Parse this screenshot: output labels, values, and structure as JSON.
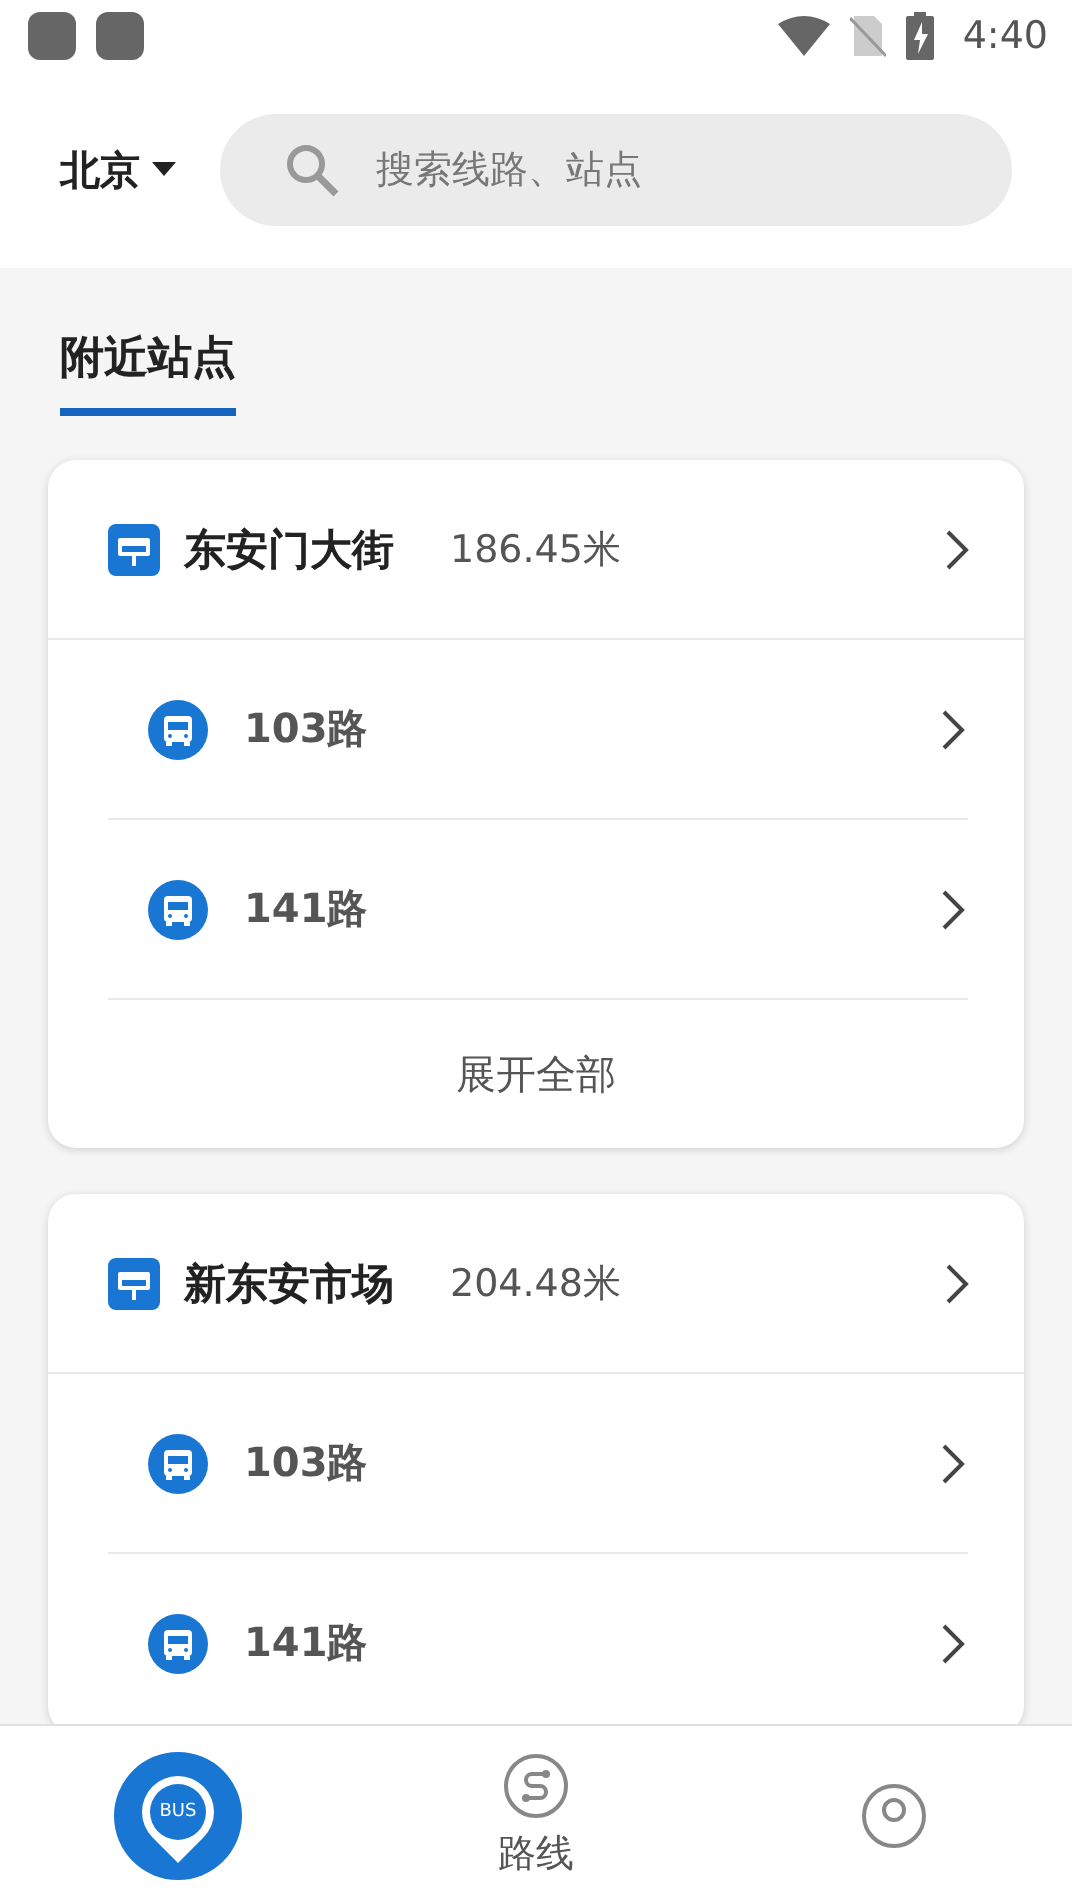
{
  "status_bar": {
    "time": "4:40"
  },
  "header": {
    "city": "北京",
    "search": {
      "placeholder": "搜索线路、站点"
    }
  },
  "section_tabs": [
    {
      "label": "附近站点",
      "selected": true
    }
  ],
  "stations": [
    {
      "name": "东安门大街",
      "distance": "186.45米",
      "routes": [
        {
          "name": "103路"
        },
        {
          "name": "141路"
        }
      ],
      "expand_label": "展开全部"
    },
    {
      "name": "新东安市场",
      "distance": "204.48米",
      "routes": [
        {
          "name": "103路"
        },
        {
          "name": "141路"
        }
      ]
    }
  ],
  "bottom_nav": [
    {
      "kind": "bus",
      "label": "BUS",
      "selected": true
    },
    {
      "kind": "route",
      "label": "路线",
      "selected": false
    },
    {
      "kind": "profile",
      "selected": false
    }
  ]
}
